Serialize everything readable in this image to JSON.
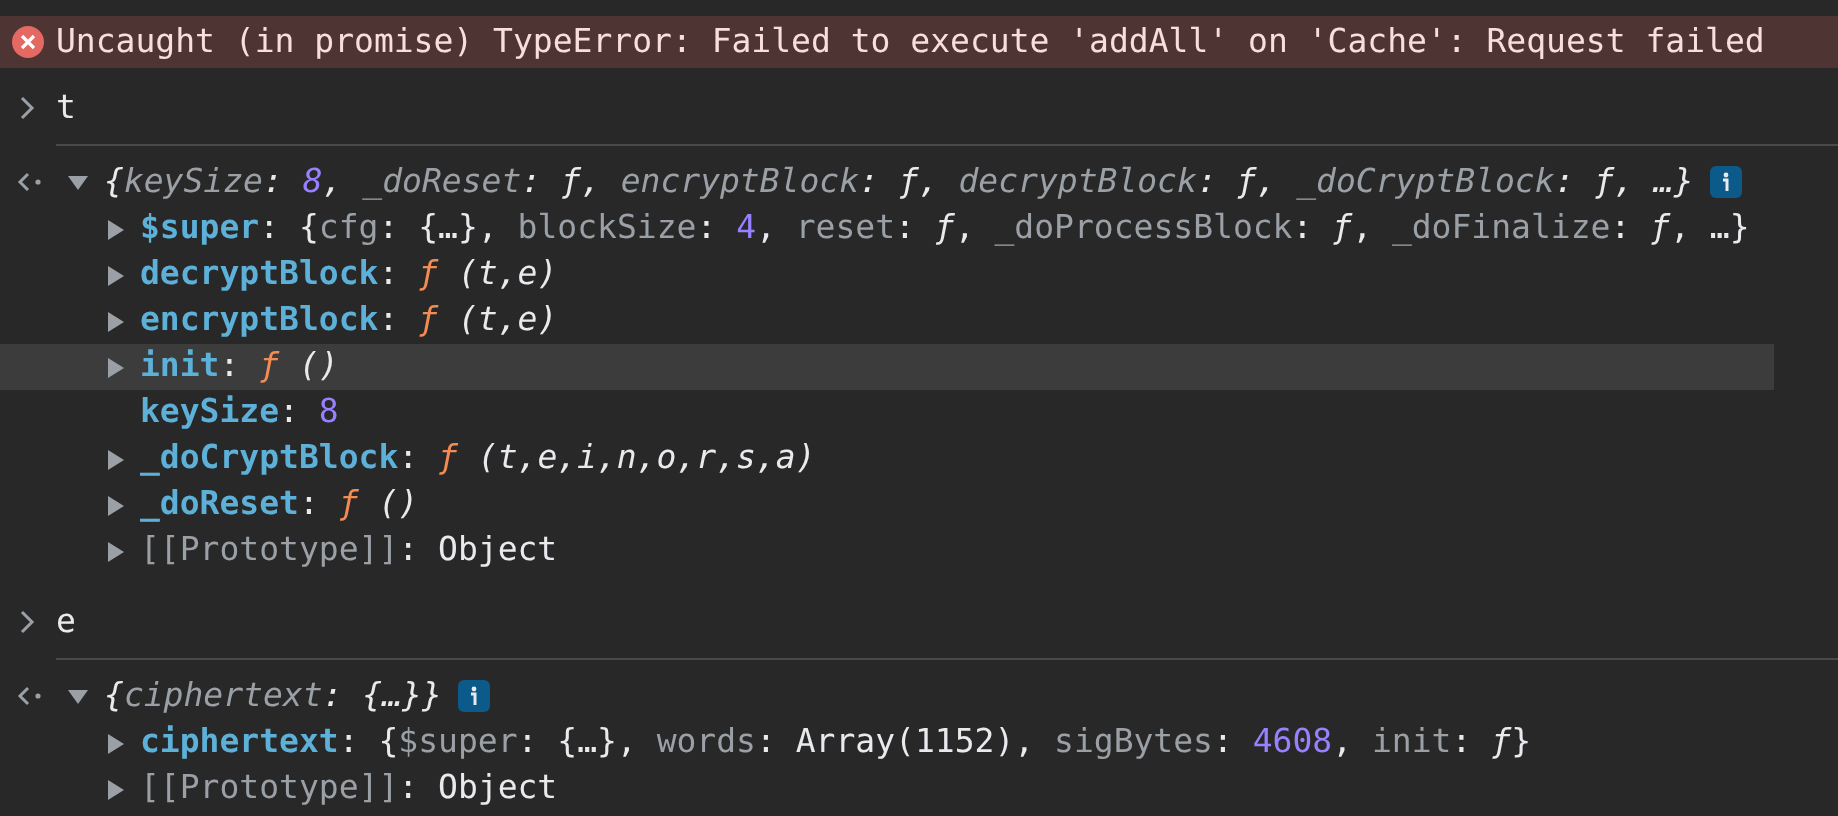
{
  "error": {
    "message": "Uncaught (in promise) TypeError: Failed to execute 'addAll' on 'Cache': Request failed"
  },
  "entries": [
    {
      "kind": "input",
      "text": "t"
    },
    {
      "kind": "output",
      "expanded": true,
      "preview": [
        {
          "t": "{",
          "kind": "p"
        },
        {
          "t": "keySize",
          "kind": "k"
        },
        {
          "t": ": ",
          "kind": "p"
        },
        {
          "t": "8",
          "kind": "n"
        },
        {
          "t": ", ",
          "kind": "p"
        },
        {
          "t": "_doReset",
          "kind": "k"
        },
        {
          "t": ": ƒ, ",
          "kind": "p"
        },
        {
          "t": "encryptBlock",
          "kind": "k"
        },
        {
          "t": ": ƒ, ",
          "kind": "p"
        },
        {
          "t": "decryptBlock",
          "kind": "k"
        },
        {
          "t": ": ƒ, ",
          "kind": "p"
        },
        {
          "t": "_doCryptBlock",
          "kind": "k"
        },
        {
          "t": ": ƒ, …}",
          "kind": "p"
        }
      ],
      "children": [
        {
          "name": "$super",
          "kind": "own",
          "expandable": true,
          "highlighted": false,
          "value": [
            {
              "t": ": {",
              "kind": "p"
            },
            {
              "t": "cfg",
              "kind": "k"
            },
            {
              "t": ": {…}, ",
              "kind": "p"
            },
            {
              "t": "blockSize",
              "kind": "k"
            },
            {
              "t": ": ",
              "kind": "p"
            },
            {
              "t": "4",
              "kind": "n"
            },
            {
              "t": ", ",
              "kind": "p"
            },
            {
              "t": "reset",
              "kind": "k"
            },
            {
              "t": ": ",
              "kind": "p"
            },
            {
              "t": "ƒ",
              "kind": "a"
            },
            {
              "t": ", ",
              "kind": "p"
            },
            {
              "t": "_doProcessBlock",
              "kind": "k"
            },
            {
              "t": ": ",
              "kind": "p"
            },
            {
              "t": "ƒ",
              "kind": "a"
            },
            {
              "t": ", ",
              "kind": "p"
            },
            {
              "t": "_doFinalize",
              "kind": "k"
            },
            {
              "t": ": ",
              "kind": "p"
            },
            {
              "t": "ƒ",
              "kind": "a"
            },
            {
              "t": ", …}",
              "kind": "p"
            }
          ]
        },
        {
          "name": "decryptBlock",
          "kind": "own",
          "expandable": true,
          "highlighted": false,
          "value": [
            {
              "t": ": ",
              "kind": "p"
            },
            {
              "t": "ƒ",
              "kind": "f"
            },
            {
              "t": " (t,e)",
              "kind": "a"
            }
          ]
        },
        {
          "name": "encryptBlock",
          "kind": "own",
          "expandable": true,
          "highlighted": false,
          "value": [
            {
              "t": ": ",
              "kind": "p"
            },
            {
              "t": "ƒ",
              "kind": "f"
            },
            {
              "t": " (t,e)",
              "kind": "a"
            }
          ]
        },
        {
          "name": "init",
          "kind": "own",
          "expandable": true,
          "highlighted": true,
          "value": [
            {
              "t": ": ",
              "kind": "p"
            },
            {
              "t": "ƒ",
              "kind": "f"
            },
            {
              "t": " ()",
              "kind": "a"
            }
          ]
        },
        {
          "name": "keySize",
          "kind": "own",
          "expandable": false,
          "highlighted": false,
          "value": [
            {
              "t": ": ",
              "kind": "p"
            },
            {
              "t": "8",
              "kind": "n"
            }
          ]
        },
        {
          "name": "_doCryptBlock",
          "kind": "own",
          "expandable": true,
          "highlighted": false,
          "value": [
            {
              "t": ": ",
              "kind": "p"
            },
            {
              "t": "ƒ",
              "kind": "f"
            },
            {
              "t": " (t,e,i,n,o,r,s,a)",
              "kind": "a"
            }
          ]
        },
        {
          "name": "_doReset",
          "kind": "own",
          "expandable": true,
          "highlighted": false,
          "value": [
            {
              "t": ": ",
              "kind": "p"
            },
            {
              "t": "ƒ",
              "kind": "f"
            },
            {
              "t": " ()",
              "kind": "a"
            }
          ]
        },
        {
          "name": "[[Prototype]]",
          "kind": "internal",
          "expandable": true,
          "highlighted": false,
          "value": [
            {
              "t": ": ",
              "kind": "p"
            },
            {
              "t": "Object",
              "kind": "s"
            }
          ]
        }
      ]
    },
    {
      "kind": "input",
      "text": "e"
    },
    {
      "kind": "output",
      "expanded": true,
      "preview": [
        {
          "t": "{",
          "kind": "p"
        },
        {
          "t": "ciphertext",
          "kind": "k"
        },
        {
          "t": ": {…}}",
          "kind": "p"
        }
      ],
      "children": [
        {
          "name": "ciphertext",
          "kind": "own",
          "expandable": true,
          "highlighted": false,
          "value": [
            {
              "t": ": {",
              "kind": "p"
            },
            {
              "t": "$super",
              "kind": "k"
            },
            {
              "t": ": {…}, ",
              "kind": "p"
            },
            {
              "t": "words",
              "kind": "k"
            },
            {
              "t": ": ",
              "kind": "p"
            },
            {
              "t": "Array(1152)",
              "kind": "s"
            },
            {
              "t": ", ",
              "kind": "p"
            },
            {
              "t": "sigBytes",
              "kind": "k"
            },
            {
              "t": ": ",
              "kind": "p"
            },
            {
              "t": "4608",
              "kind": "n"
            },
            {
              "t": ", ",
              "kind": "p"
            },
            {
              "t": "init",
              "kind": "k"
            },
            {
              "t": ": ",
              "kind": "p"
            },
            {
              "t": "ƒ",
              "kind": "a"
            },
            {
              "t": "}",
              "kind": "p"
            }
          ]
        },
        {
          "name": "[[Prototype]]",
          "kind": "internal",
          "expandable": true,
          "highlighted": false,
          "value": [
            {
              "t": ": ",
              "kind": "p"
            },
            {
              "t": "Object",
              "kind": "s"
            }
          ]
        }
      ]
    }
  ]
}
